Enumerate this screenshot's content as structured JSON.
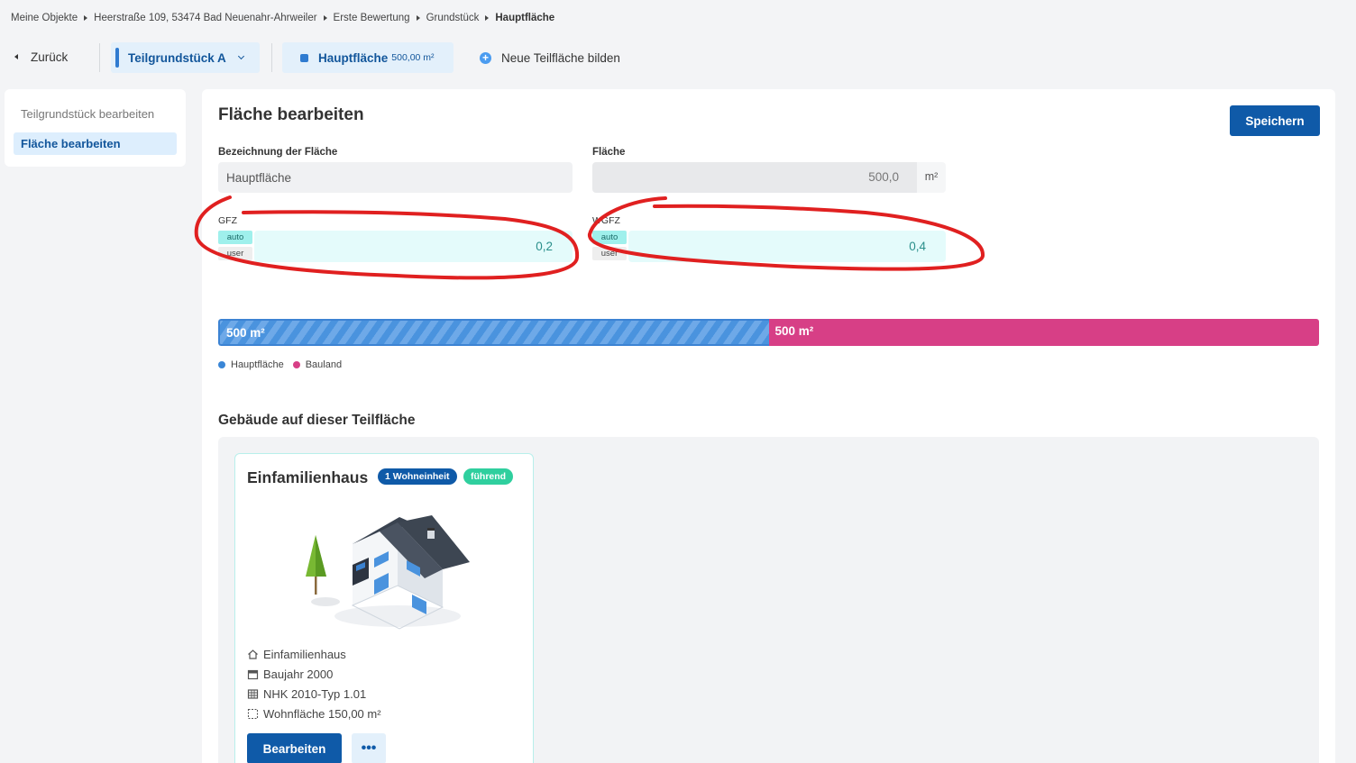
{
  "breadcrumb": [
    {
      "label": "Meine Objekte"
    },
    {
      "label": "Heerstraße 109, 53474 Bad Neuenahr-Ahrweiler"
    },
    {
      "label": "Erste Bewertung"
    },
    {
      "label": "Grundstück"
    },
    {
      "label": "Hauptfläche"
    }
  ],
  "topbar": {
    "back_label": "Zurück",
    "plot_tab_label": "Teilgrundstück A",
    "area_tab_name": "Hauptfläche",
    "area_tab_size": "500,00 m²",
    "new_area_label": "Neue Teilfläche bilden"
  },
  "sidebar": {
    "items": [
      {
        "label": "Teilgrundstück bearbeiten",
        "active": false
      },
      {
        "label": "Fläche bearbeiten",
        "active": true
      }
    ]
  },
  "main": {
    "title": "Fläche bearbeiten",
    "save_label": "Speichern",
    "name_field": {
      "label": "Bezeichnung der Fläche",
      "value": "Hauptfläche"
    },
    "area_field": {
      "label": "Fläche",
      "value": "500,0",
      "unit": "m²"
    },
    "gfz": {
      "label": "GFZ",
      "value": "0,2",
      "toggle_auto": "auto",
      "toggle_user": "user"
    },
    "wgfz": {
      "label": "WGFZ",
      "value": "0,4",
      "toggle_auto": "auto",
      "toggle_user": "user"
    }
  },
  "distribution": {
    "segments": [
      {
        "label": "500 m²",
        "name": "Hauptfläche",
        "color": "#4a93de",
        "share": 0.5
      },
      {
        "label": "500 m²",
        "name": "Bauland",
        "color": "#d73f86",
        "share": 0.5
      }
    ]
  },
  "buildings": {
    "section_title": "Gebäude auf dieser Teilfläche",
    "cards": [
      {
        "title": "Einfamilienhaus",
        "badge_units": "1 Wohneinheit",
        "badge_lead": "führend",
        "props": [
          {
            "icon": "home-icon",
            "text": "Einfamilienhaus"
          },
          {
            "icon": "calendar-icon",
            "text": "Baujahr 2000"
          },
          {
            "icon": "table-icon",
            "text": "NHK 2010-Typ 1.01"
          },
          {
            "icon": "area-icon",
            "text": "Wohnfläche 150,00 m²"
          }
        ],
        "edit_label": "Bearbeiten",
        "more_label": "•••"
      }
    ]
  },
  "colors": {
    "primary": "#0f5aa8",
    "accent_teal": "#2fcf9e",
    "annotation_red": "#e02020"
  }
}
